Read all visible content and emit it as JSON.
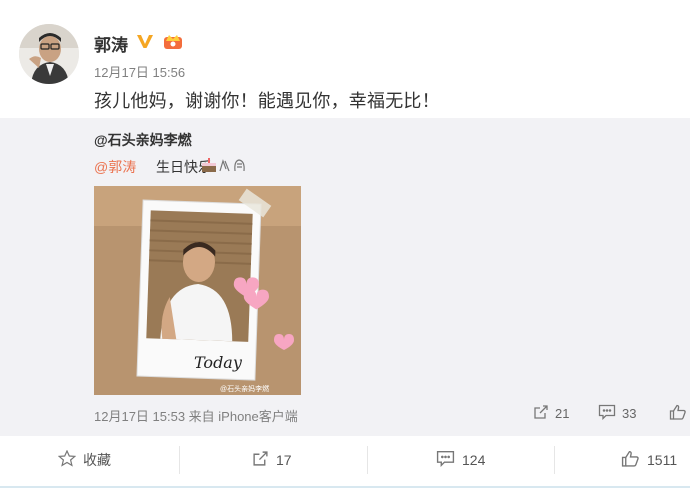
{
  "post": {
    "author": "郭涛",
    "time": "12月17日 15:56",
    "text": "孩儿他妈，谢谢你！能遇见你，幸福无比！"
  },
  "repost": {
    "author": "@石头亲妈李燃",
    "mention": "@郭涛",
    "text": "生日快乐",
    "image_caption": "Today",
    "watermark": "@石头亲妈李燃",
    "time_source": "12月17日 15:53 来自 iPhone客户端",
    "share_count": "21",
    "comment_count": "33",
    "like_count": ""
  },
  "actions": {
    "favorite": "收藏",
    "share": "17",
    "comment": "124",
    "like": "1511"
  },
  "colors": {
    "mention": "#eb7350",
    "verified": "#f5a623",
    "panel_bg": "#f2f2f5"
  },
  "icons": [
    "verified-icon",
    "member-crown-icon",
    "share-icon",
    "comment-icon",
    "like-icon",
    "star-icon",
    "cake-emoji-icon",
    "clap-emoji-icon"
  ]
}
